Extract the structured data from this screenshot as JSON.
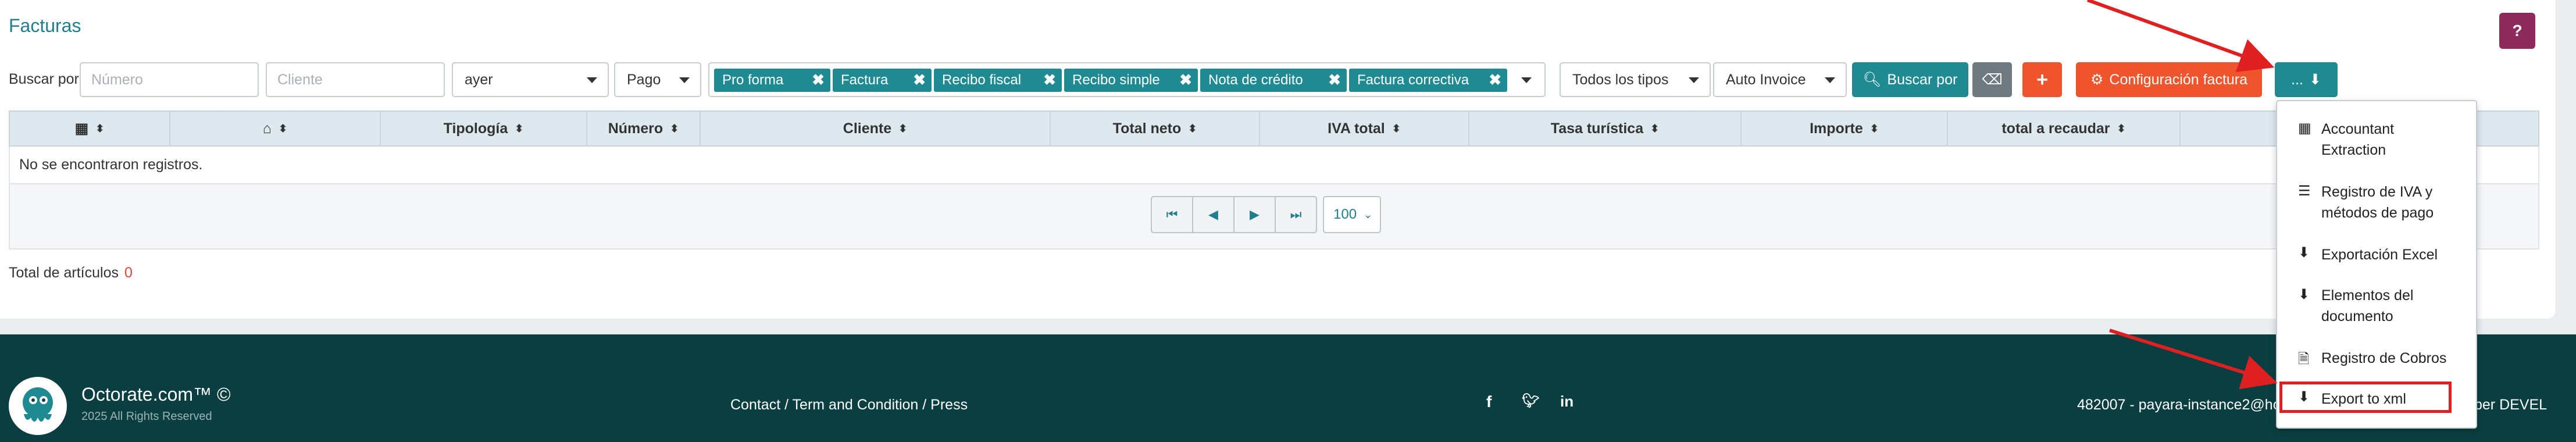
{
  "page": {
    "title": "Facturas",
    "help_label": "?"
  },
  "search": {
    "label": "Buscar por",
    "numero_placeholder": "Número",
    "cliente_placeholder": "Cliente",
    "date_value": "ayer",
    "pago_value": "Pago",
    "tags": [
      "Pro forma",
      "Factura",
      "Recibo fiscal",
      "Recibo simple",
      "Nota de crédito",
      "Factura correctiva"
    ],
    "tipos_value": "Todos los tipos",
    "auto_value": "Auto Invoice",
    "buscar_label": "Buscar por",
    "add_label": "+",
    "config_label": "Configuración factura",
    "more_label": "..."
  },
  "table": {
    "headers": [
      "",
      "",
      "Tipología",
      "Número",
      "Cliente",
      "Total neto",
      "IVA total",
      "Tasa turística",
      "Importe",
      "total a recaudar"
    ],
    "empty_text": "No se encontraron registros.",
    "per_page": "100"
  },
  "totals": {
    "label": "Total de artículos",
    "value": "0"
  },
  "footer": {
    "brand": "Octorate.com™ ©",
    "rights": "2025 All Rights Reserved",
    "links": "Contact / Term and Condition / Press",
    "instance": "482007 - payara-instance2@ho",
    "devel": "per DEVEL"
  },
  "dropdown": {
    "items": [
      {
        "label_line1": "Accountant",
        "label_line2": "Extraction",
        "icon": "calculator-icon"
      },
      {
        "label_line1": "Registro de IVA y",
        "label_line2": "métodos de pago",
        "icon": "list-icon"
      },
      {
        "label_line1": "Exportación Excel",
        "label_line2": "",
        "icon": "download-icon"
      },
      {
        "label_line1": "Elementos del",
        "label_line2": "documento",
        "icon": "download-icon"
      },
      {
        "label_line1": "Registro de Cobros",
        "label_line2": "",
        "icon": "excel-file-icon"
      },
      {
        "label_line1": "Export to xml",
        "label_line2": "",
        "icon": "download-icon"
      }
    ]
  },
  "colors": {
    "teal": "#1f8a92",
    "orange": "#f0542d",
    "gray": "#6e7a80",
    "help": "#8e2a5c",
    "footer_bg": "#0b3e40",
    "annotation_red": "#e02020"
  }
}
